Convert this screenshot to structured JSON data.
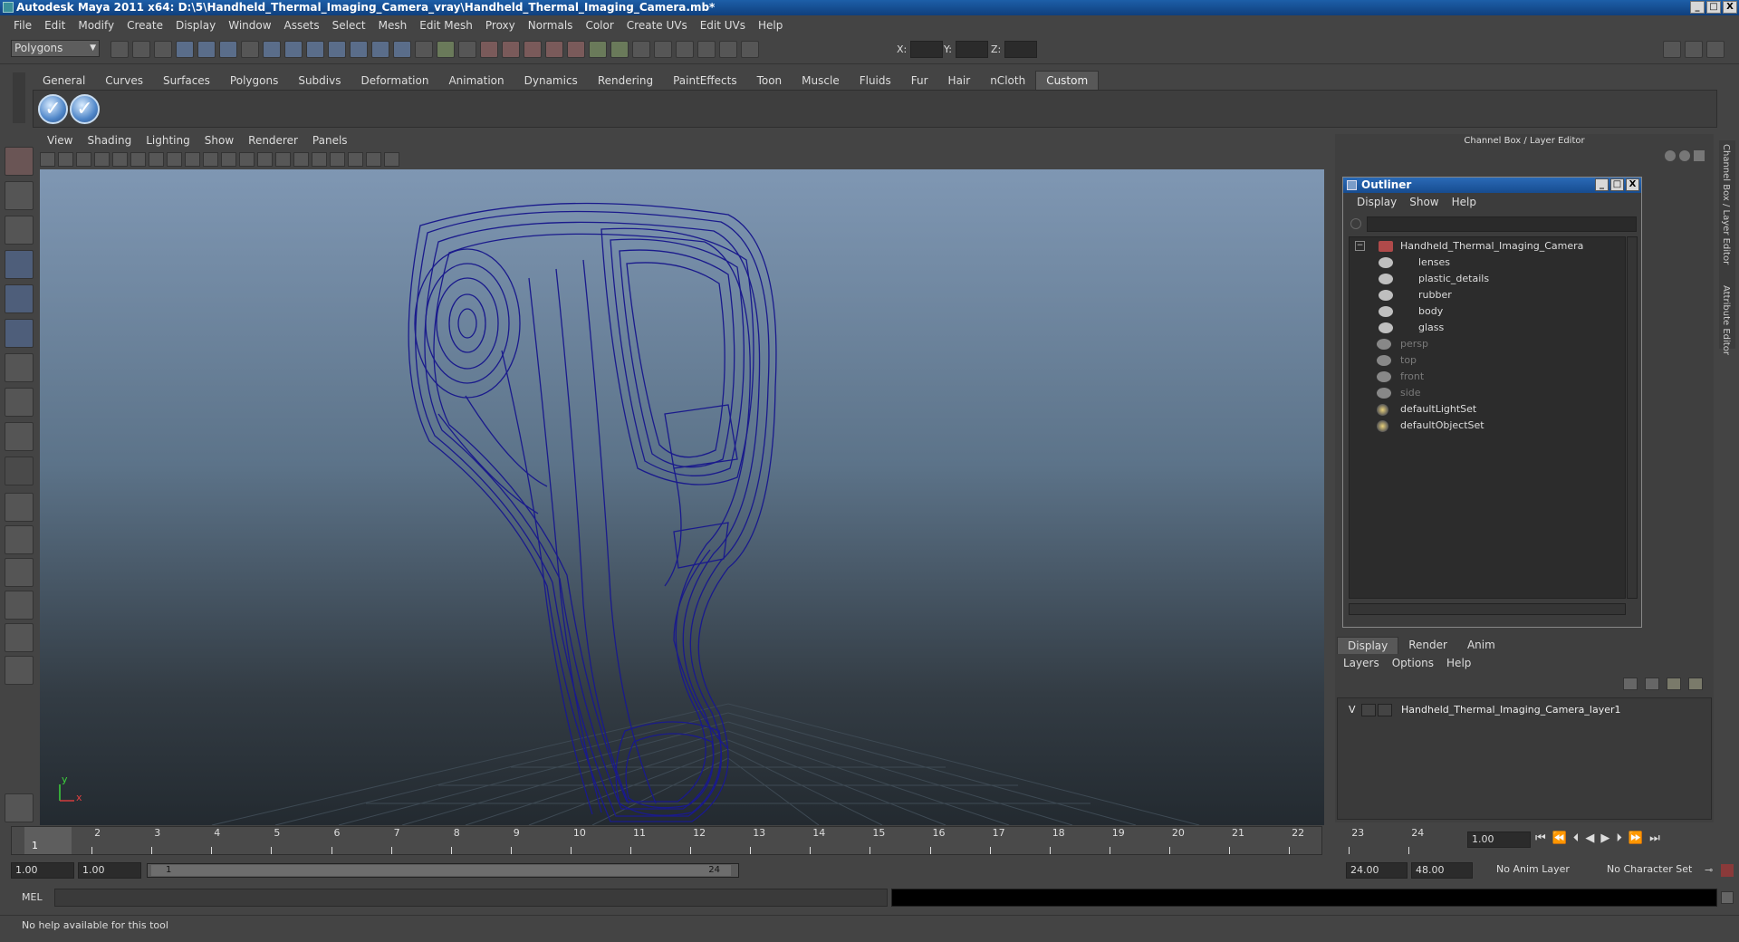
{
  "window": {
    "title": "Autodesk Maya 2011 x64: D:\\5\\Handheld_Thermal_Imaging_Camera_vray\\Handheld_Thermal_Imaging_Camera.mb*",
    "controls": [
      "_",
      "□",
      "X"
    ]
  },
  "menubar": [
    "File",
    "Edit",
    "Modify",
    "Create",
    "Display",
    "Window",
    "Assets",
    "Select",
    "Mesh",
    "Edit Mesh",
    "Proxy",
    "Normals",
    "Color",
    "Create UVs",
    "Edit UVs",
    "Help"
  ],
  "status_line": {
    "mode": "Polygons",
    "x_label": "X:",
    "y_label": "Y:",
    "z_label": "Z:"
  },
  "shelf": {
    "tabs": [
      "General",
      "Curves",
      "Surfaces",
      "Polygons",
      "Subdivs",
      "Deformation",
      "Animation",
      "Dynamics",
      "Rendering",
      "PaintEffects",
      "Toon",
      "Muscle",
      "Fluids",
      "Fur",
      "Hair",
      "nCloth",
      "Custom"
    ],
    "active_tab": "Custom"
  },
  "viewport": {
    "menu": [
      "View",
      "Shading",
      "Lighting",
      "Show",
      "Renderer",
      "Panels"
    ],
    "axis_x": "x",
    "axis_y": "y",
    "wire_color": "#1a1a8c",
    "bg_top": "#7f97b3",
    "bg_bottom": "#232a30"
  },
  "channel_box": {
    "title": "Channel Box / Layer Editor"
  },
  "outliner": {
    "title": "Outliner",
    "menu": [
      "Display",
      "Show",
      "Help"
    ],
    "root": "Handheld_Thermal_Imaging_Camera",
    "children": [
      "lenses",
      "plastic_details",
      "rubber",
      "body",
      "glass"
    ],
    "cameras": [
      "persp",
      "top",
      "front",
      "side"
    ],
    "sets": [
      "defaultLightSet",
      "defaultObjectSet"
    ]
  },
  "layer_editor": {
    "tabs": [
      "Display",
      "Render",
      "Anim"
    ],
    "active_tab": "Display",
    "menu": [
      "Layers",
      "Options",
      "Help"
    ],
    "layer": {
      "visible": "V",
      "name": "Handheld_Thermal_Imaging_Camera_layer1"
    }
  },
  "side_tabs": [
    "Channel Box / Layer Editor",
    "Attribute Editor"
  ],
  "timeline": {
    "ticks": [
      "1",
      "2",
      "3",
      "4",
      "5",
      "6",
      "7",
      "8",
      "9",
      "10",
      "11",
      "12",
      "13",
      "14",
      "15",
      "16",
      "17",
      "18",
      "19",
      "20",
      "21",
      "22",
      "23",
      "24"
    ],
    "current_marker": "1",
    "current_frame": "1.00"
  },
  "range_slider": {
    "start": "1.00",
    "playback_start": "1.00",
    "range_start_label": "1",
    "range_end_label": "24",
    "playback_end": "24.00",
    "end": "48.00",
    "anim_layer": "No Anim Layer",
    "character_set": "No Character Set"
  },
  "command_line": {
    "label": "MEL"
  },
  "help_line": {
    "text": "No help available for this tool"
  }
}
